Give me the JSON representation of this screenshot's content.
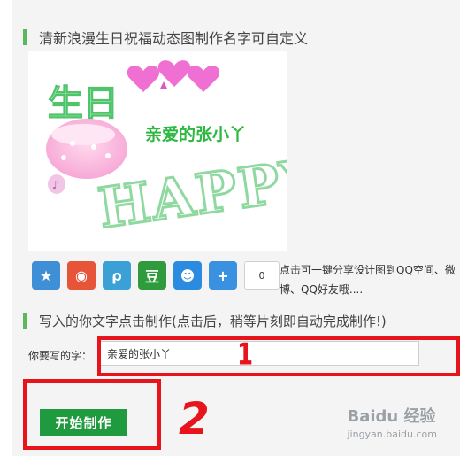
{
  "page": {
    "title": "清新浪漫生日祝福动态图制作名字可自定义",
    "section2_title": "写入的你文字点击制作(点击后，稍等片刻即自动完成制作!)"
  },
  "preview": {
    "name_text": "亲爱的张小丫",
    "birthday_text": "生日",
    "happy_text": "HAPPY"
  },
  "share": {
    "buttons": [
      {
        "icon": "qzone-star-icon",
        "color": "#3f8fd6"
      },
      {
        "icon": "weibo-icon",
        "color": "#e6553a"
      },
      {
        "icon": "tencent-weibo-icon",
        "color": "#3aa0d6"
      },
      {
        "icon": "douban-icon",
        "color": "#2f9b3c"
      },
      {
        "icon": "qq-penguin-icon",
        "color": "#2a8be0"
      },
      {
        "icon": "more-plus-icon",
        "color": "#3a91e0"
      }
    ],
    "count": "0",
    "note": "点击可一键分享设计图到QQ空间、微博、QQ好友哦...."
  },
  "form": {
    "label": "你要写的字：",
    "value": "亲爱的张小丫",
    "start_label": "开始制作"
  },
  "annotations": {
    "step1": "1",
    "step2": "2",
    "color": "#e8141b"
  },
  "watermark": {
    "brand": "Baidu 经验",
    "url": "jingyan.baidu.com"
  }
}
